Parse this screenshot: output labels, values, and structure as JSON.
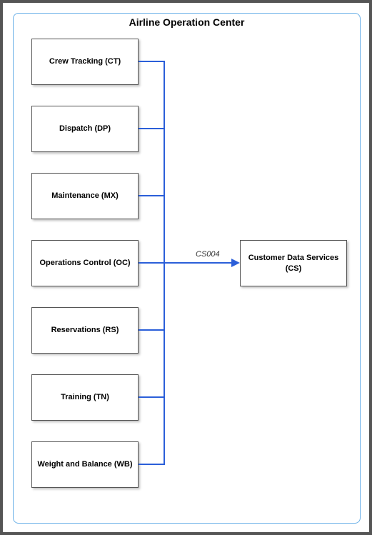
{
  "container": {
    "title": "Airline Operation Center"
  },
  "sourceNodes": [
    {
      "label": "Crew Tracking (CT)"
    },
    {
      "label": "Dispatch (DP)"
    },
    {
      "label": "Maintenance (MX)"
    },
    {
      "label": "Operations Control (OC)"
    },
    {
      "label": "Reservations (RS)"
    },
    {
      "label": "Training (TN)"
    },
    {
      "label": "Weight and Balance (WB)"
    }
  ],
  "targetNode": {
    "label": "Customer Data Services (CS)"
  },
  "edge": {
    "label": "CS004"
  }
}
